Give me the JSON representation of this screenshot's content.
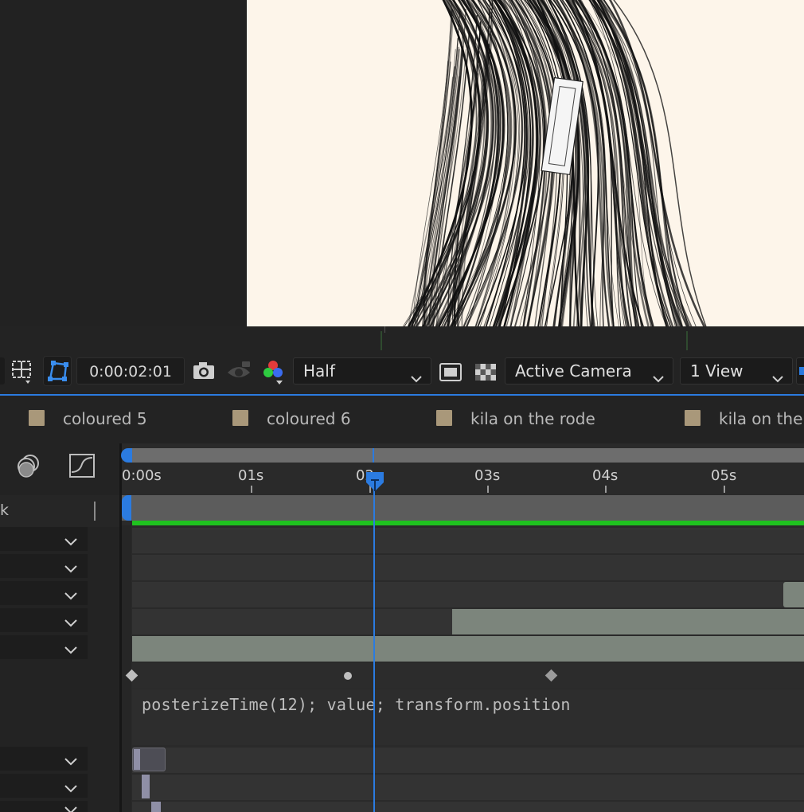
{
  "toolbar": {
    "timecode": "0:00:02:01",
    "resolution": "Half",
    "camera": "Active Camera",
    "views": "1 View"
  },
  "comp_tabs": [
    {
      "label": "coloured 5"
    },
    {
      "label": "coloured 6"
    },
    {
      "label": "kila on the rode"
    },
    {
      "label": "kila on the"
    }
  ],
  "timeline": {
    "search_partial": "k",
    "ruler": [
      "0:00s",
      "01s",
      "02s",
      "03s",
      "04s",
      "05s"
    ],
    "expression": "posterizeTime(12); value; transform.position"
  },
  "colors": {
    "accent_blue": "#2b7be0",
    "work_area_green": "#1fc21f",
    "layer_bar": "#7c857c",
    "label_swatch": "#a9987a",
    "canvas": "#fdf5ea"
  },
  "icons": [
    "region-of-interest-icon",
    "mask-path-icon",
    "camera-icon",
    "show-snapshot-icon",
    "color-channels-icon",
    "fast-previews-icon",
    "transparency-grid-icon",
    "draft-3d-icon",
    "graph-editor-icon"
  ]
}
